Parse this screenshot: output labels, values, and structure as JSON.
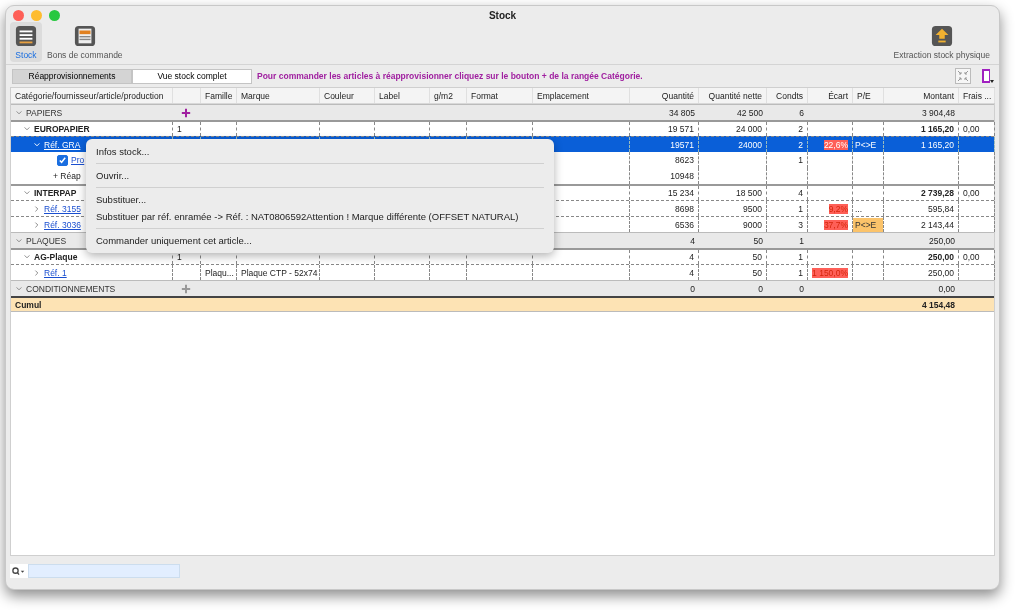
{
  "window": {
    "title": "Stock"
  },
  "toolbar": [
    {
      "label": "Stock",
      "selected": true
    },
    {
      "label": "Bons de commande",
      "selected": false
    }
  ],
  "toolbar_right": {
    "label": "Extraction stock physique"
  },
  "tabs": [
    {
      "label": "Réapprovisionnements",
      "selected": true
    },
    {
      "label": "Vue stock complet",
      "selected": false
    }
  ],
  "hint": "Pour commander les articles à réapprovisionner cliquez sur le bouton + de la rangée Catégorie.",
  "columns": [
    "Catégorie/fournisseur/article/production",
    "Famille",
    "Marque",
    "Couleur",
    "Label",
    "g/m2",
    "Format",
    "Emplacement",
    "Quantité",
    "Quantité nette",
    "Condts",
    "Écart",
    "P/E",
    "Montant",
    "Frais ..."
  ],
  "rows": [
    {
      "kind": "category",
      "name": "PAPIERS",
      "expanded": true,
      "add_enabled": true,
      "qte": "34 805",
      "nette": "42 500",
      "condts": "6",
      "montant": "3 904,48"
    },
    {
      "kind": "supplier",
      "name": "EUROPAPIER",
      "expanded": true,
      "count": "1",
      "qte": "19 571",
      "nette": "24 000",
      "condts": "2",
      "montant": "1 165,20",
      "frais": "0,00"
    },
    {
      "kind": "article",
      "name": "Réf. GRA",
      "expanded": true,
      "selected": true,
      "qte": "19571",
      "nette": "24000",
      "condts": "2",
      "ecart": "22,6%",
      "pe": "P<>E",
      "pe_flag": false,
      "montant": "1 165,20"
    },
    {
      "kind": "production",
      "name": "Pro",
      "checked": true,
      "qte": "8623",
      "condts": "1"
    },
    {
      "kind": "reappro",
      "name": "+ Réap",
      "qte": "10948"
    },
    {
      "kind": "supplier",
      "name": "INTERPAP",
      "expanded": true,
      "qte": "15 234",
      "nette": "18 500",
      "condts": "4",
      "montant": "2 739,28",
      "frais": "0,00"
    },
    {
      "kind": "article",
      "name": "Réf. 3155",
      "expanded": false,
      "selected": false,
      "qte": "8698",
      "nette": "9500",
      "condts": "1",
      "ecart": "9,2%",
      "pe": "...",
      "pe_flag": false,
      "montant": "595,84"
    },
    {
      "kind": "article",
      "name": "Réf. 3036",
      "expanded": false,
      "selected": false,
      "qte": "6536",
      "nette": "9000",
      "condts": "3",
      "ecart": "37,7%",
      "pe": "P<>E",
      "pe_flag": true,
      "montant": "2 143,44"
    },
    {
      "kind": "category",
      "name": "PLAQUES",
      "expanded": true,
      "qte": "4",
      "nette": "50",
      "condts": "1",
      "montant": "250,00"
    },
    {
      "kind": "supplier",
      "name": "AG-Plaque",
      "expanded": true,
      "count": "1",
      "qte": "4",
      "nette": "50",
      "condts": "1",
      "montant": "250,00",
      "frais": "0,00"
    },
    {
      "kind": "article",
      "name": "Réf. 1",
      "expanded": false,
      "selected": false,
      "famille": "Plaqu...",
      "marque": "Plaque CTP - 52x74",
      "qte": "4",
      "nette": "50",
      "condts": "1",
      "ecart": "1 150,0%",
      "montant": "250,00"
    },
    {
      "kind": "category",
      "name": "CONDITIONNEMENTS",
      "expanded": true,
      "add_enabled": false,
      "qte": "0",
      "nette": "0",
      "condts": "0",
      "montant": "0,00"
    },
    {
      "kind": "total",
      "name": "Cumul",
      "montant": "4 154,48"
    }
  ],
  "context_menu": [
    [
      "Infos stock..."
    ],
    [
      "Ouvrir..."
    ],
    [
      "Substituer...",
      "Substituer par réf. enramée -> Réf. : NAT0806592Attention ! Marque différente (OFFSET NATURAL)"
    ],
    [
      "Commander uniquement cet article..."
    ]
  ]
}
